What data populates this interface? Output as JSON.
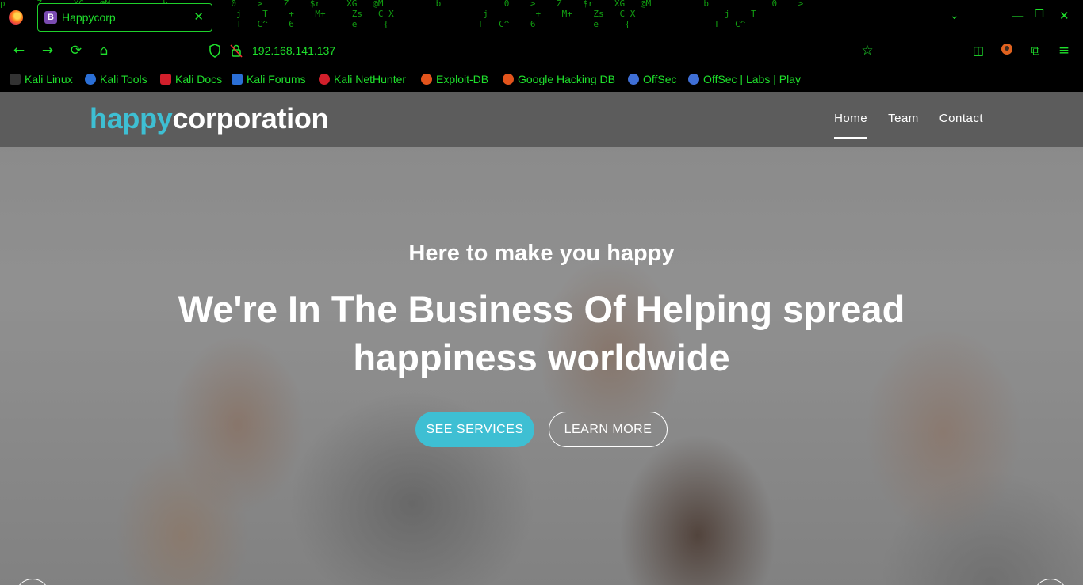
{
  "browser": {
    "tab_title": "Happycorp",
    "tab_favicon_letter": "B",
    "url": "192.168.141.137",
    "accent_color": "#1fe02c"
  },
  "bookmarks": [
    {
      "label": "Kali Linux",
      "icon": "kali-dragon-icon",
      "color": "#333333"
    },
    {
      "label": "Kali Tools",
      "icon": "kali-tools-icon",
      "color": "#2b6fd6"
    },
    {
      "label": "Kali Docs",
      "icon": "kali-docs-icon",
      "color": "#d21f2b"
    },
    {
      "label": "Kali Forums",
      "icon": "kali-forums-icon",
      "color": "#2b6fd6"
    },
    {
      "label": "Kali NetHunter",
      "icon": "nethunter-icon",
      "color": "#d21f2b"
    },
    {
      "label": "Exploit-DB",
      "icon": "exploit-db-icon",
      "color": "#e3541c"
    },
    {
      "label": "Google Hacking DB",
      "icon": "ghdb-icon",
      "color": "#e3541c"
    },
    {
      "label": "OffSec",
      "icon": "offsec-icon",
      "color": "#3f6fd6"
    },
    {
      "label": "OffSec | Labs | Play",
      "icon": "offsec-labs-icon",
      "color": "#3f6fd6"
    }
  ],
  "site": {
    "logo_part1": "happy",
    "logo_part2": "corporation",
    "brand_color": "#3ebfd3",
    "menu": [
      {
        "label": "Home",
        "active": true
      },
      {
        "label": "Team",
        "active": false
      },
      {
        "label": "Contact",
        "active": false
      }
    ]
  },
  "hero": {
    "subtitle": "Here to make you happy",
    "title_line1": "We're In The Business Of Helping spread",
    "title_line2": "happiness worldwide",
    "primary_button": "SEE SERVICES",
    "secondary_button": "LEARN MORE"
  }
}
